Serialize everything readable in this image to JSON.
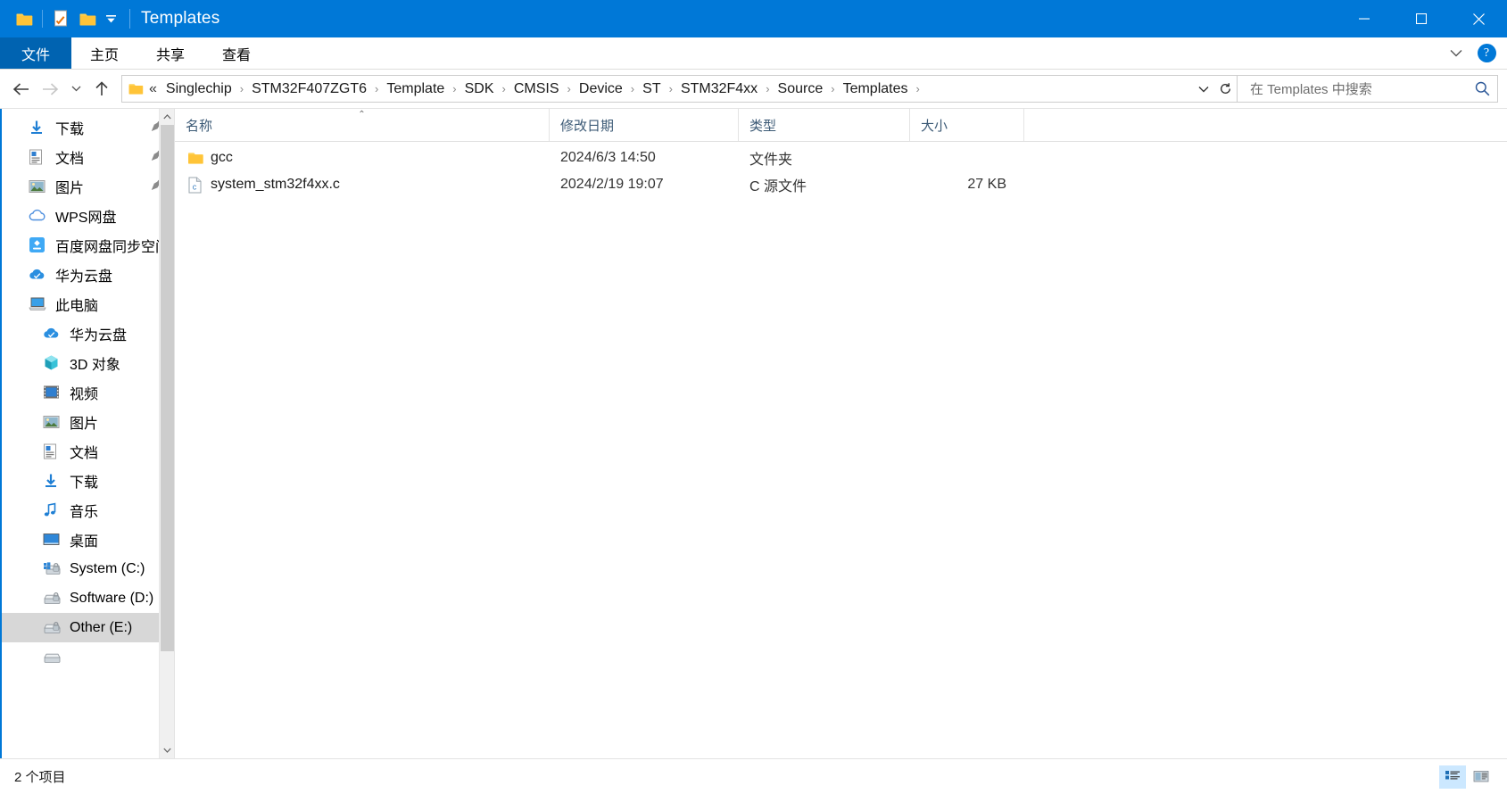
{
  "window": {
    "title": "Templates",
    "quick_access": [
      {
        "name": "folder-icon",
        "label": "文件夹"
      },
      {
        "name": "properties-icon",
        "label": "属性"
      },
      {
        "name": "new-folder-icon",
        "label": "新建文件夹"
      }
    ],
    "customize_caret": "▾",
    "controls": {
      "minimize": "─",
      "maximize": "☐",
      "close": "✕"
    }
  },
  "ribbon": {
    "file_tab": "文件",
    "tabs": [
      {
        "label": "主页"
      },
      {
        "label": "共享"
      },
      {
        "label": "查看"
      }
    ],
    "collapse_caret": "⌄",
    "help": "?"
  },
  "address": {
    "back": "←",
    "forward": "→",
    "recent_caret": "⌄",
    "up": "↑",
    "ellipsis": "«",
    "breadcrumbs": [
      {
        "label": "Singlechip"
      },
      {
        "label": "STM32F407ZGT6"
      },
      {
        "label": "Template"
      },
      {
        "label": "SDK"
      },
      {
        "label": "CMSIS"
      },
      {
        "label": "Device"
      },
      {
        "label": "ST"
      },
      {
        "label": "STM32F4xx"
      },
      {
        "label": "Source"
      },
      {
        "label": "Templates"
      }
    ],
    "separator": "›",
    "dropdown_caret": "⌄",
    "refresh": "↻"
  },
  "search": {
    "placeholder": "在 Templates 中搜索"
  },
  "sidebar": {
    "items": [
      {
        "label": "下载",
        "icon": "download-icon",
        "pinned": true,
        "indent": 1,
        "selected": false
      },
      {
        "label": "文档",
        "icon": "documents-icon",
        "pinned": true,
        "indent": 1,
        "selected": false
      },
      {
        "label": "图片",
        "icon": "pictures-icon",
        "pinned": true,
        "indent": 1,
        "selected": false
      },
      {
        "label": "WPS网盘",
        "icon": "wps-cloud-icon",
        "pinned": false,
        "indent": 0,
        "selected": false
      },
      {
        "label": "百度网盘同步空间",
        "icon": "baidu-netdisk-icon",
        "pinned": false,
        "indent": 0,
        "selected": false
      },
      {
        "label": "华为云盘",
        "icon": "huawei-cloud-icon",
        "pinned": false,
        "indent": 0,
        "selected": false
      },
      {
        "label": "此电脑",
        "icon": "this-pc-icon",
        "pinned": false,
        "indent": 0,
        "selected": false
      },
      {
        "label": "华为云盘",
        "icon": "huawei-cloud-icon",
        "pinned": false,
        "indent": 1,
        "selected": false
      },
      {
        "label": "3D 对象",
        "icon": "3d-objects-icon",
        "pinned": false,
        "indent": 1,
        "selected": false
      },
      {
        "label": "视频",
        "icon": "videos-icon",
        "pinned": false,
        "indent": 1,
        "selected": false
      },
      {
        "label": "图片",
        "icon": "pictures-icon",
        "pinned": false,
        "indent": 1,
        "selected": false
      },
      {
        "label": "文档",
        "icon": "documents-icon",
        "pinned": false,
        "indent": 1,
        "selected": false
      },
      {
        "label": "下载",
        "icon": "download-icon",
        "pinned": false,
        "indent": 1,
        "selected": false
      },
      {
        "label": "音乐",
        "icon": "music-icon",
        "pinned": false,
        "indent": 1,
        "selected": false
      },
      {
        "label": "桌面",
        "icon": "desktop-icon",
        "pinned": false,
        "indent": 1,
        "selected": false
      },
      {
        "label": "System (C:)",
        "icon": "drive-windows-locked-icon",
        "pinned": false,
        "indent": 1,
        "selected": false
      },
      {
        "label": "Software (D:)",
        "icon": "drive-locked-icon",
        "pinned": false,
        "indent": 1,
        "selected": false
      },
      {
        "label": "Other (E:)",
        "icon": "drive-locked-icon",
        "pinned": false,
        "indent": 1,
        "selected": true
      }
    ],
    "scroll_up": "⌃",
    "scroll_down": "⌄"
  },
  "columns": [
    {
      "key": "name",
      "label": "名称",
      "sorted": true,
      "sort_caret": "⌃"
    },
    {
      "key": "date",
      "label": "修改日期",
      "sorted": false,
      "sort_caret": ""
    },
    {
      "key": "type",
      "label": "类型",
      "sorted": false,
      "sort_caret": ""
    },
    {
      "key": "size",
      "label": "大小",
      "sorted": false,
      "sort_caret": ""
    }
  ],
  "files": [
    {
      "name": "gcc",
      "date": "2024/6/3 14:50",
      "type": "文件夹",
      "size": "",
      "icon": "folder-icon"
    },
    {
      "name": "system_stm32f4xx.c",
      "date": "2024/2/19 19:07",
      "type": "C 源文件",
      "size": "27 KB",
      "icon": "c-source-file-icon"
    }
  ],
  "status": {
    "item_count": "2 个项目",
    "views": [
      {
        "name": "details-view",
        "label": "详细信息",
        "active": true
      },
      {
        "name": "large-icons-view",
        "label": "大图标",
        "active": false
      }
    ]
  },
  "colors": {
    "accent": "#0078d7",
    "file_tab": "#0063b1",
    "selection": "#d7d7d7",
    "hover": "#e5f3fb",
    "header_text": "#3c5a76"
  }
}
